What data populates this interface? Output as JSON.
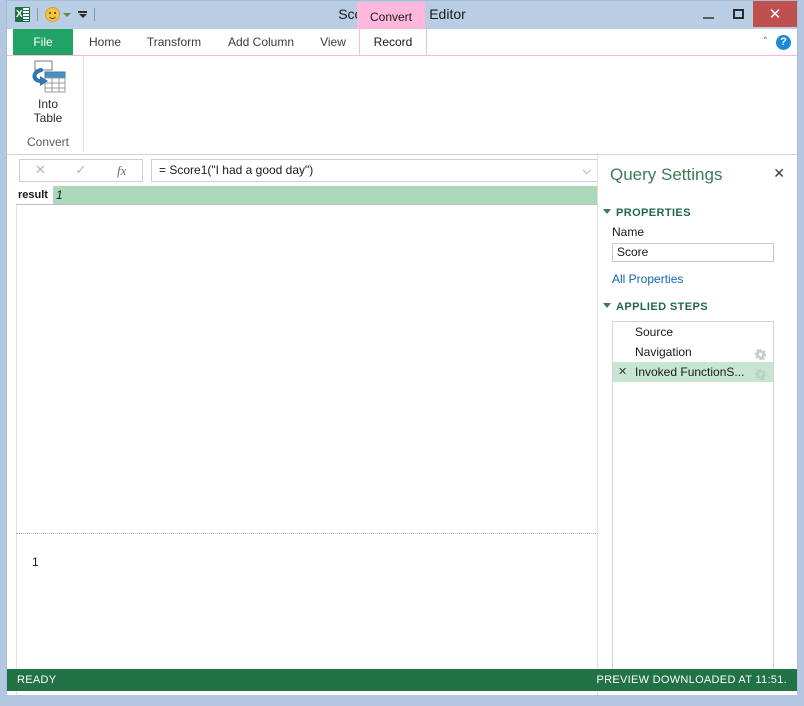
{
  "window": {
    "title": "Score - Query Editor",
    "quick_access": {
      "app_icon": "excel-icon",
      "smiley_icon": "smiley-icon",
      "customize_icon": "customize-quick-access-icon"
    },
    "controls": {
      "minimize": "minimize-icon",
      "maximize": "maximize-icon",
      "close": "✕"
    },
    "close_color": "#c0504d"
  },
  "contextual_tab": {
    "label": "Convert",
    "color": "#ffb8dc"
  },
  "ribbon": {
    "tabs": [
      {
        "label": "File",
        "active": false,
        "is_file": true
      },
      {
        "label": "Home",
        "active": false,
        "is_file": false
      },
      {
        "label": "Transform",
        "active": false,
        "is_file": false
      },
      {
        "label": "Add Column",
        "active": false,
        "is_file": false
      },
      {
        "label": "View",
        "active": false,
        "is_file": false
      },
      {
        "label": "Record",
        "active": true,
        "is_file": false
      }
    ],
    "collapse_icon": "˄",
    "help_icon": "?",
    "groups": [
      {
        "name": "Convert",
        "buttons": [
          {
            "label_line1": "Into",
            "label_line2": "Table",
            "icon": "into-table-icon"
          }
        ]
      }
    ]
  },
  "formula_bar": {
    "cancel_icon": "✕",
    "enter_icon": "✓",
    "fx_icon": "fx",
    "value": "= Score1(\"I had a good day\")",
    "expand_icon": "⌵"
  },
  "result_row": {
    "caption": "result",
    "value": "1",
    "highlight_color": "#a9d8bb"
  },
  "preview": {
    "value": "1"
  },
  "query_settings": {
    "title": "Query Settings",
    "close_icon": "✕",
    "properties": {
      "section_label": "PROPERTIES",
      "name_label": "Name",
      "name_value": "Score",
      "all_properties_link": "All Properties"
    },
    "applied_steps": {
      "section_label": "APPLIED STEPS",
      "steps": [
        {
          "label": "Source",
          "selected": false,
          "has_delete": false,
          "has_gear": false
        },
        {
          "label": "Navigation",
          "selected": false,
          "has_delete": false,
          "has_gear": true
        },
        {
          "label": "Invoked FunctionS...",
          "selected": true,
          "has_delete": true,
          "has_gear": true
        }
      ]
    }
  },
  "status_bar": {
    "left": "READY",
    "right": "PREVIEW DOWNLOADED AT 11:51.",
    "color": "#217346"
  }
}
